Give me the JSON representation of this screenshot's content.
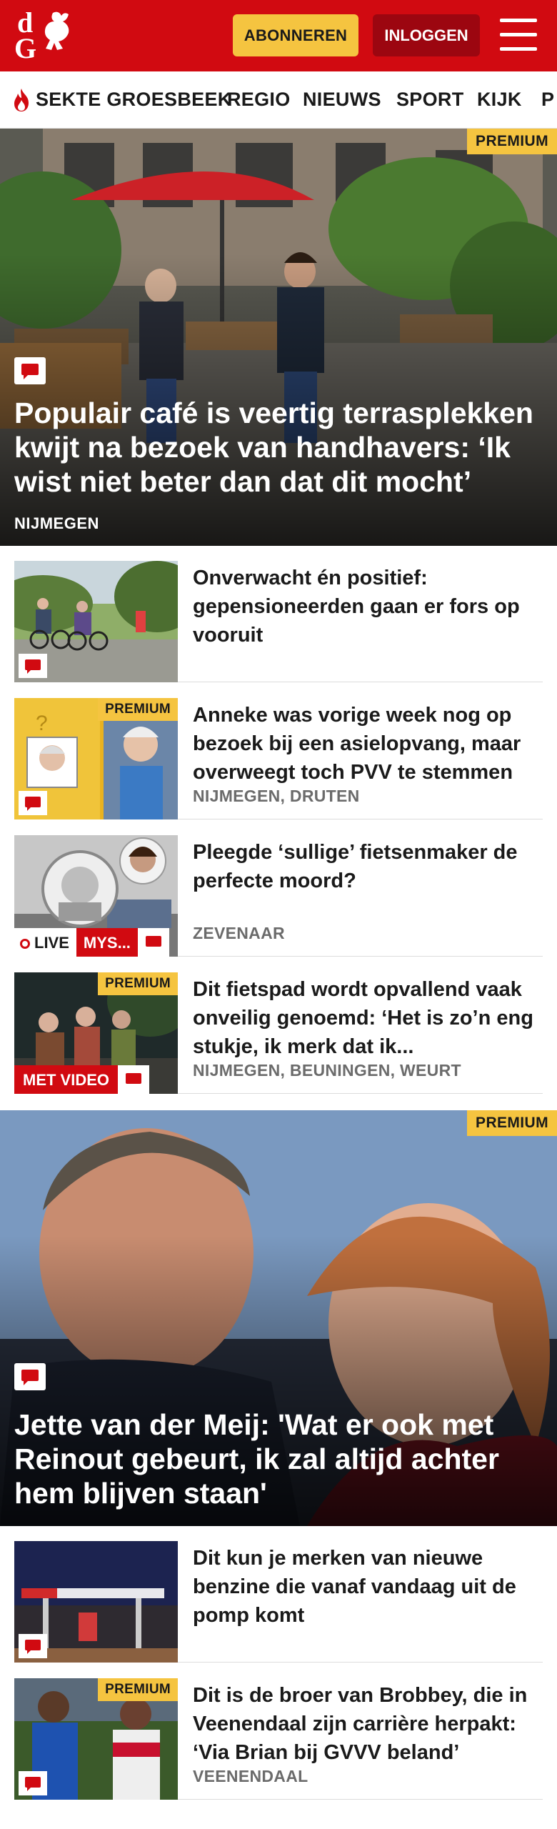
{
  "header": {
    "logo_letters": [
      "d",
      "G"
    ],
    "subscribe_label": "ABONNEREN",
    "login_label": "INLOGGEN"
  },
  "nav": {
    "items": [
      "SEKTE GROESBEEK",
      "REGIO",
      "NIEUWS",
      "SPORT",
      "KIJK",
      "P"
    ]
  },
  "badges": {
    "premium": "PREMIUM",
    "live": "LIVE",
    "mystery": "MYS...",
    "video": "MET VIDEO"
  },
  "hero1": {
    "title": "Populair café is veertig terrasplekken kwijt na bezoek van handhavers: ‘Ik wist niet beter dan dat dit mocht’",
    "location": "NIJMEGEN",
    "premium": true
  },
  "articles": [
    {
      "title": "Onverwacht én positief: gepensioneerden gaan er fors op vooruit",
      "location": "",
      "premium": false
    },
    {
      "title": "Anneke was vorige week nog op bezoek bij een asielopvang, maar overweegt toch PVV te stemmen",
      "location": "NIJMEGEN, DRUTEN",
      "premium": true
    },
    {
      "title": "Pleegde ‘sullige’ fietsenmaker de perfecte moord?",
      "location": "ZEVENAAR",
      "premium": false,
      "live": true
    },
    {
      "title": "Dit fietspad wordt opvallend vaak onveilig genoemd: ‘Het is zo’n eng stukje, ik merk dat ik...",
      "location": "NIJMEGEN, BEUNINGEN, WEURT",
      "premium": true,
      "video": true
    }
  ],
  "hero2": {
    "title": "Jette van der Meij: 'Wat er ook met Reinout gebeurt, ik zal altijd achter hem blijven staan'",
    "premium": true
  },
  "articles2": [
    {
      "title": "Dit kun je merken van nieuwe benzine die vanaf vandaag uit de pomp komt",
      "location": "",
      "premium": false
    },
    {
      "title": "Dit is de broer van Brobbey, die in Veenendaal zijn carrière herpakt: ‘Via Brian bij GVVV beland’",
      "location": "VEENENDAAL",
      "premium": true
    }
  ],
  "colors": {
    "brand_red": "#d10a11",
    "premium_yellow": "#f5c440",
    "login_dark_red": "#9c0610"
  }
}
